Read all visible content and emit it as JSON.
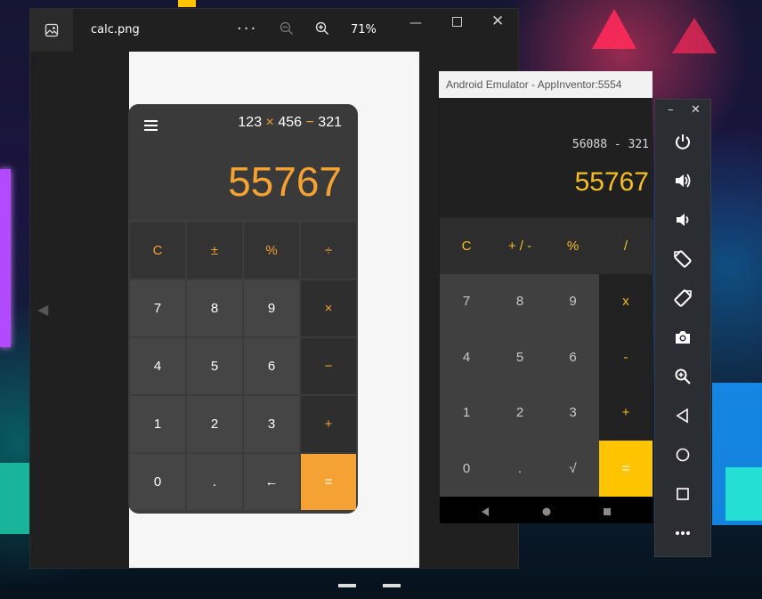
{
  "photos": {
    "title": "calc.png",
    "more_label": "···",
    "zoom_level": "71%",
    "minimize_label": "—",
    "close_label": "✕",
    "prev_label": "◀"
  },
  "calc_image": {
    "expression": {
      "a": "123",
      "op1": "×",
      "b": "456",
      "op2": "−",
      "c": "321"
    },
    "result": "55767",
    "keys": [
      {
        "label": "C",
        "kind": "fn"
      },
      {
        "label": "±",
        "kind": "fn"
      },
      {
        "label": "%",
        "kind": "fn"
      },
      {
        "label": "÷",
        "kind": "fn"
      },
      {
        "label": "7",
        "kind": "num"
      },
      {
        "label": "8",
        "kind": "num"
      },
      {
        "label": "9",
        "kind": "num"
      },
      {
        "label": "×",
        "kind": "op"
      },
      {
        "label": "4",
        "kind": "num"
      },
      {
        "label": "5",
        "kind": "num"
      },
      {
        "label": "6",
        "kind": "num"
      },
      {
        "label": "−",
        "kind": "op"
      },
      {
        "label": "1",
        "kind": "num"
      },
      {
        "label": "2",
        "kind": "num"
      },
      {
        "label": "3",
        "kind": "num"
      },
      {
        "label": "+",
        "kind": "op"
      },
      {
        "label": "0",
        "kind": "num"
      },
      {
        "label": ".",
        "kind": "num"
      },
      {
        "label": "←",
        "kind": "num"
      },
      {
        "label": "=",
        "kind": "eq"
      }
    ]
  },
  "emulator": {
    "title": "Android Emulator - AppInventor:5554",
    "expression": "56088 - 321",
    "result": "55767",
    "keys": [
      {
        "label": "C",
        "kind": "fn"
      },
      {
        "label": "+ / -",
        "kind": "fn"
      },
      {
        "label": "%",
        "kind": "fn"
      },
      {
        "label": "/",
        "kind": "fn"
      },
      {
        "label": "7",
        "kind": "num"
      },
      {
        "label": "8",
        "kind": "num"
      },
      {
        "label": "9",
        "kind": "num"
      },
      {
        "label": "x",
        "kind": "op"
      },
      {
        "label": "4",
        "kind": "num"
      },
      {
        "label": "5",
        "kind": "num"
      },
      {
        "label": "6",
        "kind": "num"
      },
      {
        "label": "-",
        "kind": "op"
      },
      {
        "label": "1",
        "kind": "num"
      },
      {
        "label": "2",
        "kind": "num"
      },
      {
        "label": "3",
        "kind": "num"
      },
      {
        "label": "+",
        "kind": "op"
      },
      {
        "label": "0",
        "kind": "num"
      },
      {
        "label": ".",
        "kind": "num"
      },
      {
        "label": "√",
        "kind": "num"
      },
      {
        "label": "=",
        "kind": "eq"
      }
    ],
    "toolbar": {
      "minimize_label": "–",
      "close_label": "✕",
      "buttons": [
        "power-icon",
        "volume-up-icon",
        "volume-down-icon",
        "rotate-left-icon",
        "rotate-right-icon",
        "camera-icon",
        "zoom-icon",
        "back-icon",
        "home-icon",
        "overview-icon",
        "more-icon"
      ]
    }
  },
  "colors": {
    "calc_accent": "#f3a233",
    "emulator_accent": "#f5bf22",
    "emulator_equals": "#fec400"
  }
}
